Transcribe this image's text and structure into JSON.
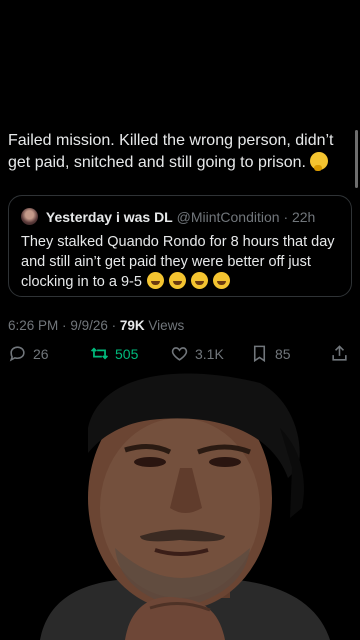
{
  "post": {
    "text": "Failed mission. Killed the wrong person, didn’t get paid, snitched and still going to prison.",
    "emoji": "thinking-face"
  },
  "quote": {
    "name": "Yesterday i was DL",
    "handle": "@MiintCondition",
    "time": "· 22h",
    "text": "They stalked Quando Rondo for 8 hours that day and still ain’t get paid they were better off just clocking in to a 9-5",
    "emojis": [
      "face-with-tears-of-joy",
      "face-with-tears-of-joy",
      "face-with-tears-of-joy",
      "face-with-tears-of-joy"
    ]
  },
  "meta": {
    "time": "6:26 PM",
    "date": "9/9/26",
    "views_count": "79K",
    "views_label": "Views"
  },
  "actions": {
    "replies": "26",
    "reposts": "505",
    "likes": "3.1K",
    "bookmarks": "85"
  },
  "colors": {
    "background": "#000000",
    "text": "#e7e9ea",
    "muted": "#71767b",
    "repost": "#00ba7c"
  }
}
